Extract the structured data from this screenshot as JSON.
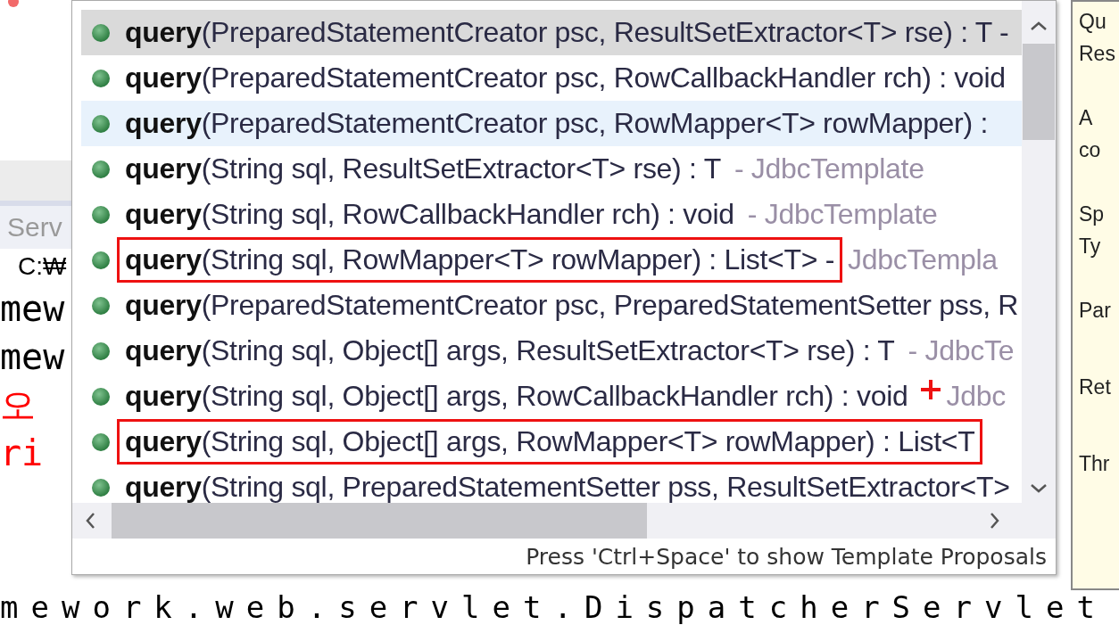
{
  "editor": {
    "tab_label": "Serv",
    "path": "C:₩",
    "lines": [
      {
        "text": "mew",
        "kind": "normal"
      },
      {
        "text": "mew",
        "kind": "normal"
      },
      {
        "text": "오",
        "kind": "error"
      },
      {
        "text": "ri",
        "kind": "error"
      }
    ],
    "bottom_line": "mework.web.servlet.DispatcherServlet"
  },
  "proposals": [
    {
      "name": "query",
      "signature": "(PreparedStatementCreator psc, ResultSetExtractor<T> rse) : T -",
      "selected": true,
      "hovered": false,
      "annotated": false
    },
    {
      "name": "query",
      "signature": "(PreparedStatementCreator psc, RowCallbackHandler rch) : void",
      "selected": false,
      "hovered": false,
      "annotated": false
    },
    {
      "name": "query",
      "signature": "(PreparedStatementCreator psc, RowMapper<T> rowMapper) :",
      "selected": false,
      "hovered": true,
      "annotated": false
    },
    {
      "name": "query",
      "signature": "(String sql, ResultSetExtractor<T> rse) : T",
      "owner": "- JdbcTemplate",
      "selected": false,
      "hovered": false,
      "annotated": false
    },
    {
      "name": "query",
      "signature": "(String sql, RowCallbackHandler rch) : void",
      "owner": "- JdbcTemplate",
      "selected": false,
      "hovered": false,
      "annotated": false
    },
    {
      "name": "query",
      "signature": "(String sql, RowMapper<T> rowMapper) : List<T> -",
      "owner": "JdbcTempla",
      "selected": false,
      "hovered": false,
      "annotated": true
    },
    {
      "name": "query",
      "signature": "(PreparedStatementCreator psc, PreparedStatementSetter pss, R",
      "selected": false,
      "hovered": false,
      "annotated": false
    },
    {
      "name": "query",
      "signature": "(String sql, Object[] args, ResultSetExtractor<T> rse) : T",
      "owner": "- JdbcTe",
      "selected": false,
      "hovered": false,
      "annotated": false
    },
    {
      "name": "query",
      "signature": "(String sql, Object[] args, RowCallbackHandler rch) : void",
      "plus_mark": true,
      "owner": "Jdbc",
      "selected": false,
      "hovered": false,
      "annotated": false
    },
    {
      "name": "query",
      "signature": "(String sql, Object[] args, RowMapper<T> rowMapper) : List<T",
      "selected": false,
      "hovered": false,
      "annotated": true
    },
    {
      "name": "query",
      "signature": "(String sql, PreparedStatementSetter pss, ResultSetExtractor<T>",
      "selected": false,
      "hovered": false,
      "annotated": false
    }
  ],
  "status": "Press 'Ctrl+Space' to show Template Proposals",
  "doc_sections": [
    {
      "lines": [
        "Qu",
        "Res"
      ]
    },
    {
      "lines": [
        "A",
        "co"
      ]
    },
    {
      "lines": [
        "Sp",
        "Ty"
      ]
    },
    {
      "lines": [
        "Par"
      ]
    },
    {
      "lines": [
        "Ret"
      ]
    },
    {
      "lines": [
        "Thr"
      ]
    }
  ]
}
